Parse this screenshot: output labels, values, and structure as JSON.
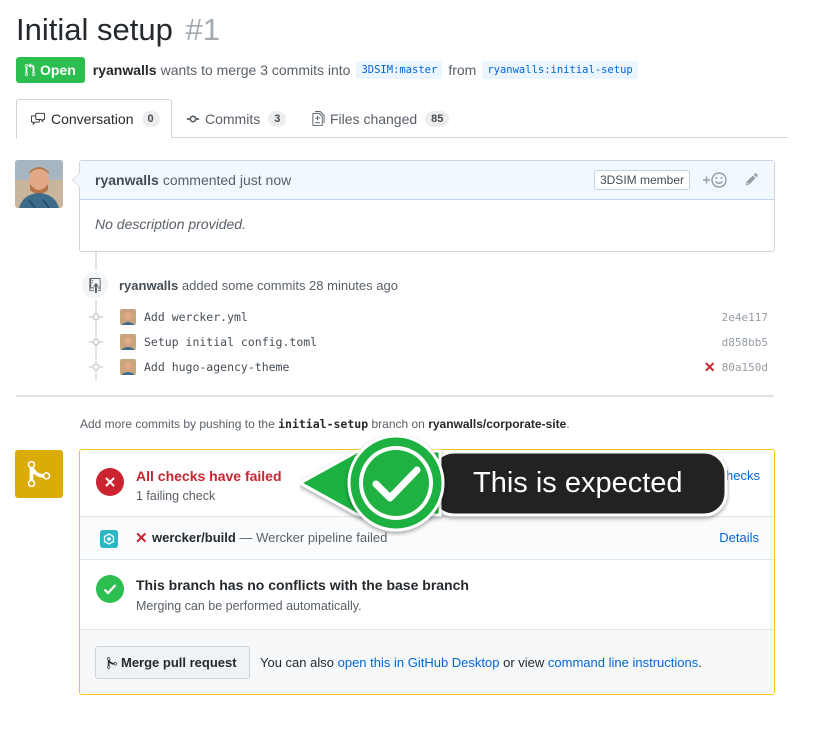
{
  "pr": {
    "title": "Initial setup",
    "number": "#1",
    "state": "Open",
    "author": "ryanwalls",
    "merge_text": "wants to merge 3 commits into",
    "base_ref": "3DSIM:master",
    "from_text": "from",
    "head_ref": "ryanwalls:initial-setup"
  },
  "tabs": [
    {
      "label": "Conversation",
      "count": "0",
      "icon": "comment-discussion-icon"
    },
    {
      "label": "Commits",
      "count": "3",
      "icon": "git-commit-icon"
    },
    {
      "label": "Files changed",
      "count": "85",
      "icon": "diff-icon"
    }
  ],
  "comment": {
    "author": "ryanwalls",
    "action": "commented just now",
    "badge": "3DSIM member",
    "body": "No description provided."
  },
  "timeline": {
    "push_author": "ryanwalls",
    "push_text": "added some commits 28 minutes ago",
    "commits": [
      {
        "message": "Add wercker.yml",
        "sha": "2e4e117",
        "failed": false
      },
      {
        "message": "Setup initial config.toml",
        "sha": "d858bb5",
        "failed": false
      },
      {
        "message": "Add hugo-agency-theme",
        "sha": "80a150d",
        "failed": true
      }
    ]
  },
  "add_more": {
    "prefix": "Add more commits by pushing to the",
    "branch": "initial-setup",
    "middle": "branch on",
    "repo": "ryanwalls/corporate-site",
    "suffix": "."
  },
  "mergebox": {
    "status_title": "All checks have failed",
    "status_sub": "1 failing check",
    "show_checks_label": "hecks",
    "check": {
      "name": "wercker/build",
      "separator": "—",
      "description": "Wercker pipeline failed",
      "details_label": "Details"
    },
    "conflicts_title": "This branch has no conflicts with the base branch",
    "conflicts_sub": "Merging can be performed automatically.",
    "merge_button": "Merge pull request",
    "alt_prefix": "You can also",
    "alt_desktop_link": "open this in GitHub Desktop",
    "alt_middle": "or view",
    "alt_cli_link": "command line instructions",
    "alt_suffix": "."
  },
  "callout": {
    "text": "This is expected"
  },
  "colors": {
    "open_green": "#2cbe4e",
    "fail_red": "#cb2431",
    "link_blue": "#0366d6",
    "warn_yellow": "#dbab09",
    "callout_green": "#1fb141",
    "callout_dark": "#222222"
  }
}
